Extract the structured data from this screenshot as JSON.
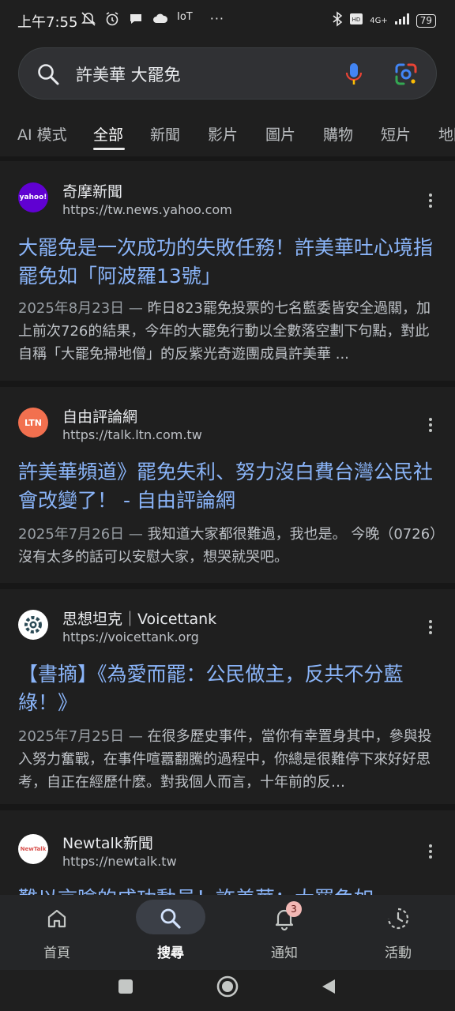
{
  "status_bar": {
    "time": "上午7:55",
    "left_icons": [
      "mute-icon",
      "alarm-icon",
      "chat-icon",
      "cloud-icon",
      "iot-icon",
      "more-icon"
    ],
    "iot_label": "IoT",
    "more_label": "···",
    "network_label": "4G+",
    "battery": "79"
  },
  "search": {
    "query": "許美華 大罷免"
  },
  "tabs": [
    "AI 模式",
    "全部",
    "新聞",
    "影片",
    "圖片",
    "購物",
    "短片",
    "地圖"
  ],
  "active_tab": "全部",
  "results": [
    {
      "site_name": "奇摩新聞",
      "url": "https://tw.news.yahoo.com",
      "favicon_text": "yahoo!",
      "favicon_color": "#6001d2",
      "title": "大罷免是一次成功的失敗任務！許美華吐心境指罷免如「阿波羅13號」",
      "date": "2025年8月23日",
      "snippet": "昨日823罷免投票的七名藍委皆安全過關，加上前次726的結果，今年的大罷免行動以全數落空劃下句點，對此自稱「大罷免掃地僧」的反紫光奇遊團成員許美華 ..."
    },
    {
      "site_name": "自由評論網",
      "url": "https://talk.ltn.com.tw",
      "favicon_text": "LTN",
      "favicon_color": "#f2704f",
      "title": "許美華頻道》罷免失利、努力沒白費台灣公民社會改變了！ - 自由評論網",
      "date": "2025年7月26日",
      "snippet": "我知道大家都很難過，我也是。 今晚（0726）沒有太多的話可以安慰大家，想哭就哭吧。"
    },
    {
      "site_name": "思想坦克｜Voicettank",
      "url": "https://voicettank.org",
      "favicon_text": "",
      "favicon_color": "#ffffff",
      "title": "【書摘】《為愛而罷：公民做主，反共不分藍綠！》",
      "date": "2025年7月25日",
      "snippet": "在很多歷史事件，當你有幸置身其中，參與投入努力奮戰，在事件喧囂翻騰的過程中，你總是很難停下來好好思考，自正在經歷什麼。對我個人而言，十年前的反…"
    },
    {
      "site_name": "Newtalk新聞",
      "url": "https://newtalk.tw",
      "favicon_text": "NewTalk",
      "favicon_color": "#ffffff",
      "title": "難以言喻的成功動員！許美華：大罷免如"
    }
  ],
  "bottom_nav": [
    {
      "label": "首頁",
      "icon": "home-icon"
    },
    {
      "label": "搜尋",
      "icon": "search-icon"
    },
    {
      "label": "通知",
      "icon": "bell-icon",
      "badge": "3"
    },
    {
      "label": "活動",
      "icon": "activity-icon"
    }
  ],
  "colors": {
    "link": "#8ab4f8",
    "background": "#1f1f1f"
  }
}
